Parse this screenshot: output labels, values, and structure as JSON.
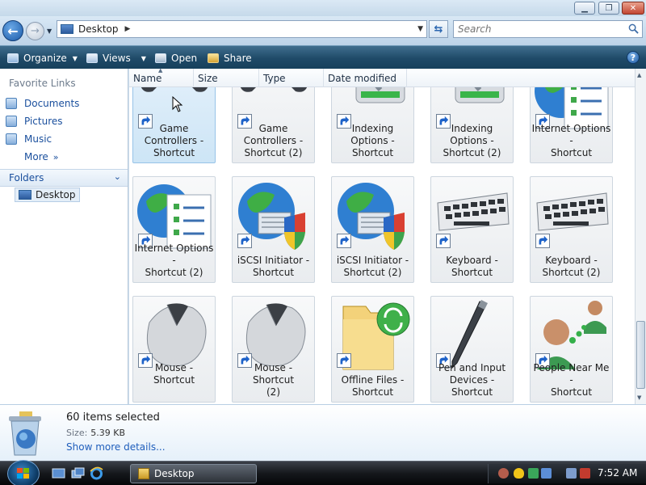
{
  "window": {
    "address": "Desktop",
    "search_placeholder": "Search"
  },
  "toolbar": {
    "organize": "Organize",
    "views": "Views",
    "open": "Open",
    "share": "Share",
    "help": "?"
  },
  "nav": {
    "favorite_links_header": "Favorite Links",
    "favorites": [
      "Documents",
      "Pictures",
      "Music",
      "More"
    ],
    "folders_header": "Folders",
    "tree_desktop": "Desktop"
  },
  "columns": [
    "Name",
    "Size",
    "Type",
    "Date modified"
  ],
  "items": [
    {
      "label1": "Game Controllers -",
      "label2": "Shortcut",
      "icon": "gamepad-icon"
    },
    {
      "label1": "Game Controllers -",
      "label2": "Shortcut (2)",
      "icon": "gamepad-icon"
    },
    {
      "label1": "Indexing Options -",
      "label2": "Shortcut",
      "icon": "indexing-icon"
    },
    {
      "label1": "Indexing Options -",
      "label2": "Shortcut (2)",
      "icon": "indexing-icon"
    },
    {
      "label1": "Internet Options -",
      "label2": "Shortcut",
      "icon": "internet-options-icon"
    },
    {
      "label1": "Internet Options -",
      "label2": "Shortcut (2)",
      "icon": "internet-options-icon"
    },
    {
      "label1": "iSCSI Initiator -",
      "label2": "Shortcut",
      "icon": "iscsi-icon"
    },
    {
      "label1": "iSCSI Initiator -",
      "label2": "Shortcut (2)",
      "icon": "iscsi-icon"
    },
    {
      "label1": "Keyboard -",
      "label2": "Shortcut",
      "icon": "keyboard-icon"
    },
    {
      "label1": "Keyboard -",
      "label2": "Shortcut (2)",
      "icon": "keyboard-icon"
    },
    {
      "label1": "Mouse - Shortcut",
      "label2": "",
      "icon": "mouse-icon"
    },
    {
      "label1": "Mouse - Shortcut",
      "label2": "(2)",
      "icon": "mouse-icon"
    },
    {
      "label1": "Offline Files -",
      "label2": "Shortcut",
      "icon": "offline-files-icon"
    },
    {
      "label1": "Pen and Input",
      "label2": "Devices - Shortcut",
      "icon": "pen-icon"
    },
    {
      "label1": "People Near Me -",
      "label2": "Shortcut",
      "icon": "people-icon"
    }
  ],
  "details": {
    "count": "60 items selected",
    "size_label": "Size:",
    "size_value": "5.39 KB",
    "more": "Show more details..."
  },
  "taskbar": {
    "task": "Desktop",
    "clock": "7:52 AM"
  }
}
